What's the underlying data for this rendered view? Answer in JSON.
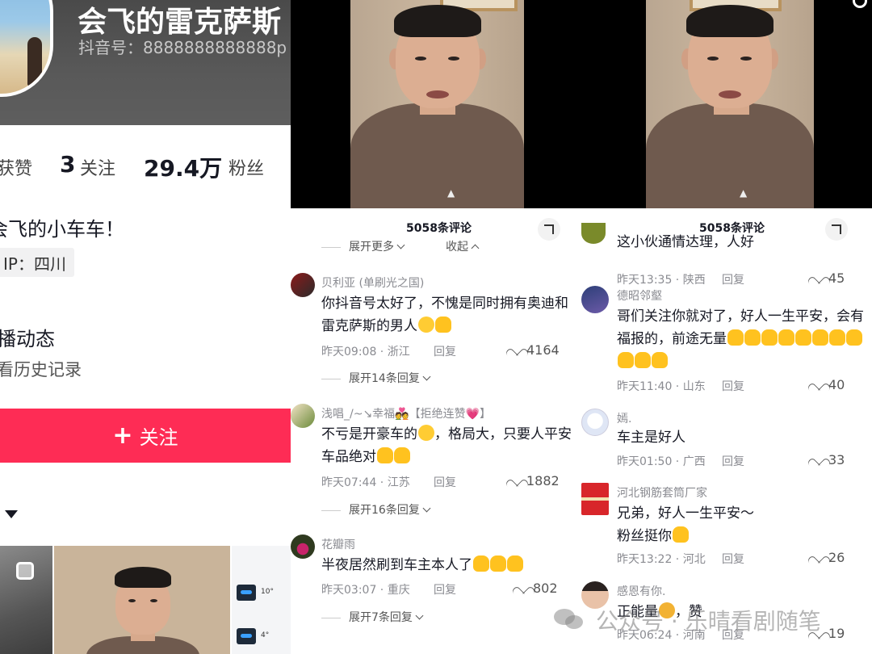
{
  "profile": {
    "nickname": "会飞的雷克萨斯",
    "douyin_id": "抖音号：8888888888888p",
    "likes_label": "获赞",
    "following_count": "3",
    "following_label": "关注",
    "fans_count": "29.4万",
    "fans_label": "粉丝",
    "bio": "会飞的小车车！",
    "ip_location": "IP：四川",
    "dynamic_title": "播动态",
    "dynamic_sub": "看历史记录",
    "follow_button": "关注",
    "thumb_values": [
      "10°",
      "4°"
    ]
  },
  "comments_left": {
    "header": "5058条评论",
    "expand_more": "展开更多",
    "collapse": "收起",
    "items": [
      {
        "user": "贝利亚 (单刷光之国)",
        "text_line1": "你抖音号太好了，不愧是同时拥有奥迪和",
        "text_line2": "雷克萨斯的男人",
        "time_place": "昨天09:08 · 浙江",
        "reply": "回复",
        "likes": "4164",
        "more_replies": "展开14条回复"
      },
      {
        "user": "浅唱_/~↘幸福💑【拒绝连赞💗】",
        "text_line1": "不亏是开豪车的",
        "text_line1b": "，格局大，只要人平安",
        "text_line2": "车品绝对",
        "time_place": "昨天07:44 · 江苏",
        "reply": "回复",
        "likes": "1882",
        "more_replies": "展开16条回复"
      },
      {
        "user": "花瓣雨",
        "text_line1": "半夜居然刷到车主本人了",
        "time_place": "昨天03:07 · 重庆",
        "reply": "回复",
        "likes": "802",
        "more_replies": "展开7条回复"
      }
    ]
  },
  "comments_right": {
    "header": "5058条评论",
    "items": [
      {
        "user": "",
        "text_line1": "这小伙通情达理，人好",
        "time_place": "昨天13:35 · 陕西",
        "reply": "回复",
        "likes": "45"
      },
      {
        "user": "德昭邻壑",
        "text_line1": "哥们关注你就对了，好人一生平安，会有",
        "text_line2": "福报的，前途无量",
        "time_place": "昨天11:40 · 山东",
        "reply": "回复",
        "likes": "40"
      },
      {
        "user": "嫣.",
        "text_line1": "车主是好人",
        "time_place": "昨天01:50 · 广西",
        "reply": "回复",
        "likes": "33"
      },
      {
        "user": "河北钢筋套筒厂家",
        "text_line1": "兄弟，好人一生平安～",
        "text_line2": "粉丝挺你",
        "time_place": "昨天13:22 · 河北",
        "reply": "回复",
        "likes": "26"
      },
      {
        "user": "感恩有你.",
        "text_line1": "正能量",
        "text_line1b": "，赞",
        "time_place": "昨天06:24 · 河南",
        "reply": "回复",
        "likes": "19"
      }
    ]
  },
  "watermark": "公众号 · 乐晴看剧随笔",
  "colors": {
    "accent": "#fe2c55",
    "muted": "#8a8b91"
  }
}
